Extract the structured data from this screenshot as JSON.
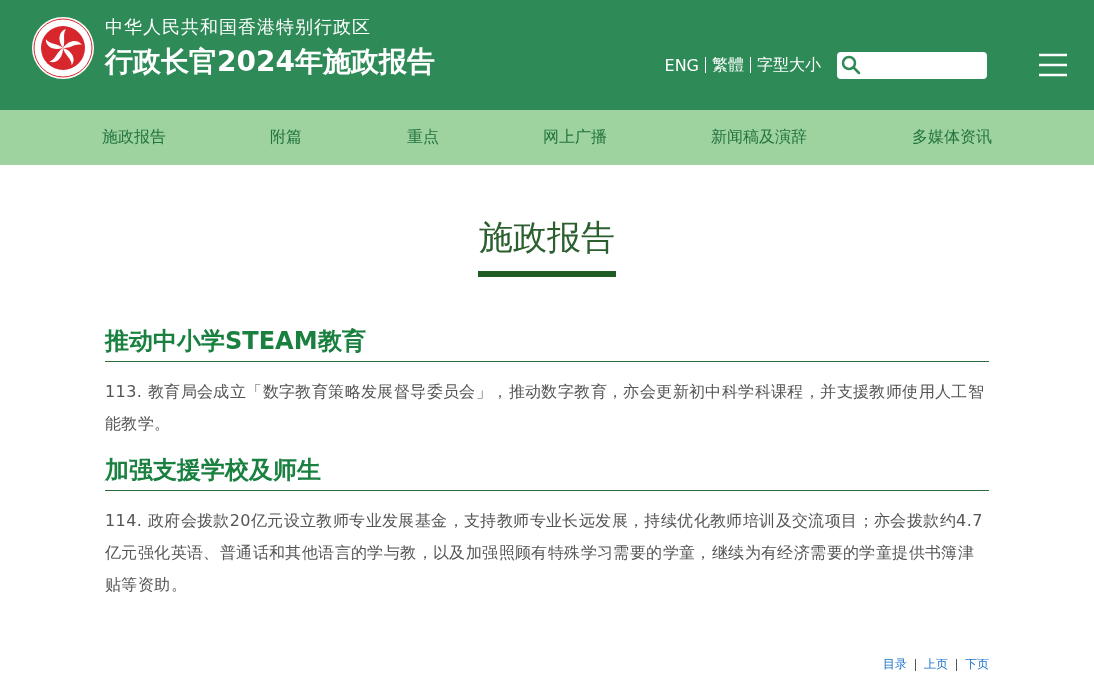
{
  "header": {
    "subtitle": "中华人民共和国香港特别行政区",
    "title": "行政长官2024年施政报告",
    "links": [
      "ENG",
      "繁體",
      "字型大小"
    ]
  },
  "nav": [
    "施政报告",
    "附篇",
    "重点",
    "网上广播",
    "新闻稿及演辞",
    "多媒体资讯"
  ],
  "page_title": "施政报告",
  "sections": [
    {
      "heading": "推动中小学STEAM教育",
      "paragraphs": [
        "113. 教育局会成立「数字教育策略发展督导委员会」，推动数字教育，亦会更新初中科学科课程，并支援教师使用人工智能教学。"
      ]
    },
    {
      "heading": "加强支援学校及师生",
      "paragraphs": [
        "114. 政府会拨款20亿元设立教师专业发展基金，支持教师专业长远发展，持续优化教师培训及交流项目；亦会拨款约4.7亿元强化英语、普通话和其他语言的学与教，以及加强照顾有特殊学习需要的学童，继续为有经济需要的学童提供书簿津贴等资助。"
      ]
    }
  ],
  "pager": [
    "目录",
    "上页",
    "下页"
  ]
}
